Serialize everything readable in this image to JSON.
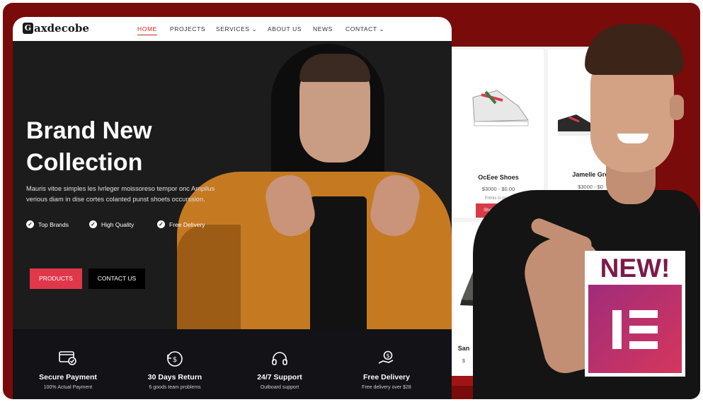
{
  "site": {
    "logo": "axdecobe",
    "logo_mark": "G",
    "nav": [
      {
        "label": "HOME",
        "active": true
      },
      {
        "label": "PROJECTS"
      },
      {
        "label": "SERVICES ⌄"
      },
      {
        "label": "ABOUT US"
      },
      {
        "label": "NEWS"
      },
      {
        "label": "CONTACT ⌄"
      }
    ],
    "hero": {
      "title_line1": "Brand New",
      "title_line2": "Collection",
      "description": "Mauris vitoe simples les lvrleger moissoreso tempor onc Ampilus verious diam in dise cortes colanted punst shoets occurssion.",
      "features": [
        "Top Brands",
        "High Quality",
        "Free Delivery"
      ],
      "products_button": "PRODUCTS",
      "contact_button": "CONTACT US"
    },
    "benefits": [
      {
        "icon": "card-check-icon",
        "title": "Secure Payment",
        "subtitle": "100% Actual Payment"
      },
      {
        "icon": "return-icon",
        "title": "30 Days Return",
        "subtitle": "6 goods team problems"
      },
      {
        "icon": "headset-icon",
        "title": "24/7 Support",
        "subtitle": "Outboard support"
      },
      {
        "icon": "hand-coin-icon",
        "title": "Free Delivery",
        "subtitle": "Free delivery over $28"
      }
    ]
  },
  "products": [
    {
      "name": "OcEee Shoes",
      "price": "$3000 - $0.00",
      "note": "Primis in plazz",
      "button": "Shard options"
    },
    {
      "name": "Jamelle Gro",
      "price": "$3000 - $0"
    },
    {
      "name": "San",
      "price": "$"
    }
  ],
  "badge": {
    "text": "NEW!"
  },
  "colors": {
    "frame": "#7a0b0b",
    "accent_red": "#e0374a",
    "hero_bg": "#1c1c1c",
    "jacket": "#c57a22",
    "badge_text": "#7b1a4a",
    "elementor_gradient": [
      "#a02c7a",
      "#d5365d"
    ]
  }
}
